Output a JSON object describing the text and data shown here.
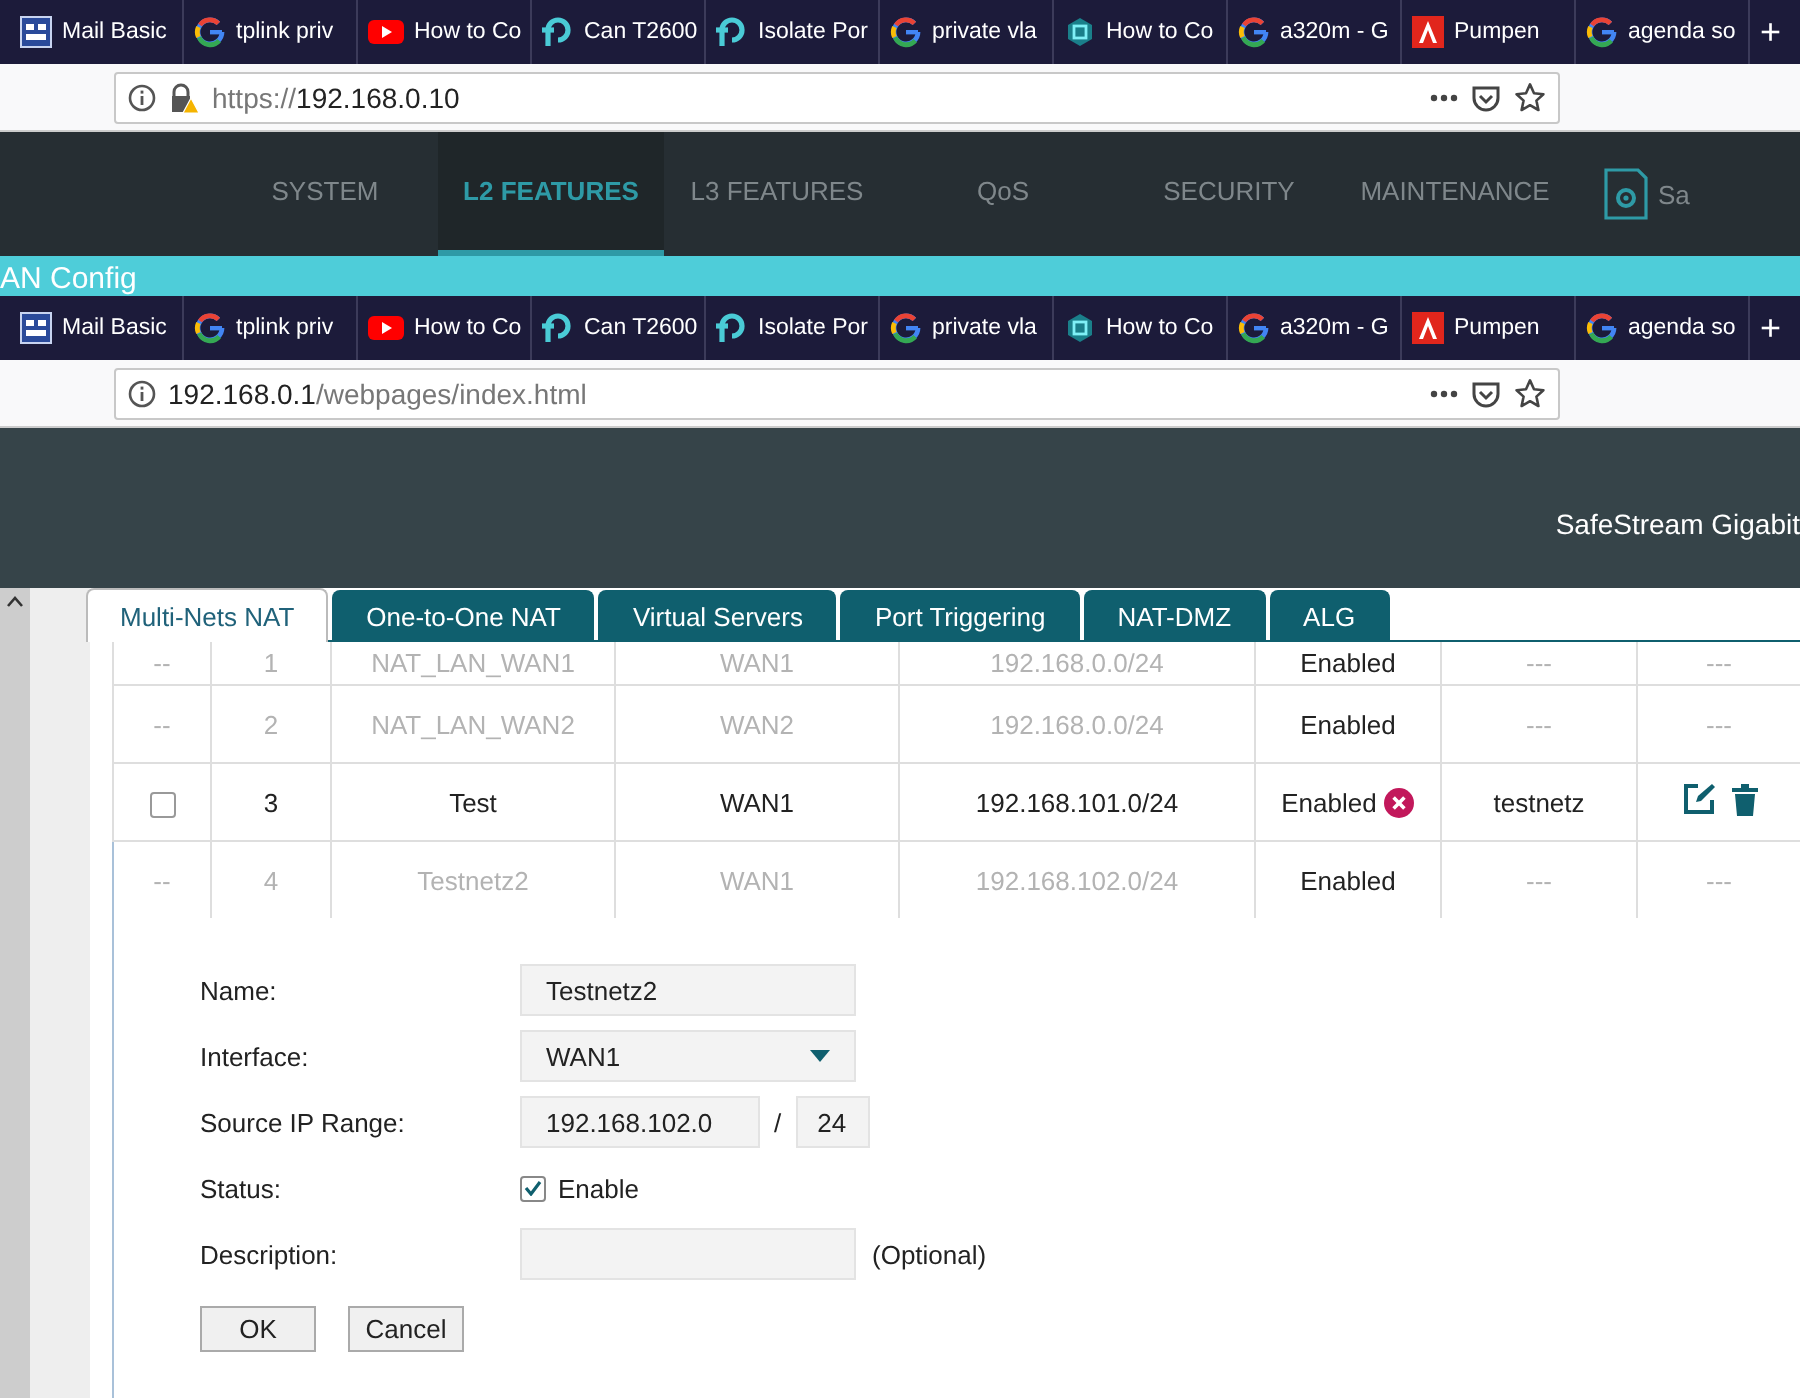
{
  "browser_windows": [
    {
      "tabs": [
        {
          "kind": "mail",
          "title": "Mail Basic"
        },
        {
          "kind": "google",
          "title": "tplink priv"
        },
        {
          "kind": "video",
          "title": "How to Co"
        },
        {
          "kind": "tplink",
          "title": "Can T2600"
        },
        {
          "kind": "tplink",
          "title": "Isolate Por"
        },
        {
          "kind": "google",
          "title": "private vla"
        },
        {
          "kind": "shield",
          "title": "How to Co"
        },
        {
          "kind": "google",
          "title": "a320m - G"
        },
        {
          "kind": "pdf",
          "title": "Pumpen"
        },
        {
          "kind": "google",
          "title": "agenda so"
        }
      ],
      "new_tab_button": "+",
      "address": {
        "scheme": "https://",
        "host": "192.168.0.10",
        "warning": true
      }
    },
    {
      "tabs": [
        {
          "kind": "mail",
          "title": "Mail Basic"
        },
        {
          "kind": "google",
          "title": "tplink priv"
        },
        {
          "kind": "video",
          "title": "How to Co"
        },
        {
          "kind": "tplink",
          "title": "Can T2600"
        },
        {
          "kind": "tplink",
          "title": "Isolate Por"
        },
        {
          "kind": "google",
          "title": "private vla"
        },
        {
          "kind": "shield",
          "title": "How to Co"
        },
        {
          "kind": "google",
          "title": "a320m - G"
        },
        {
          "kind": "pdf",
          "title": "Pumpen"
        },
        {
          "kind": "google",
          "title": "agenda so"
        }
      ],
      "new_tab_button": "+",
      "address": {
        "host": "192.168.0.1",
        "path": "/webpages/index.html",
        "warning": false
      }
    }
  ],
  "top_app": {
    "nav": [
      {
        "label": "SYSTEM",
        "selected": false
      },
      {
        "label": "L2 FEATURES",
        "selected": true
      },
      {
        "label": "L3 FEATURES",
        "selected": false
      },
      {
        "label": "QoS",
        "selected": false
      },
      {
        "label": "SECURITY",
        "selected": false
      },
      {
        "label": "MAINTENANCE",
        "selected": false
      }
    ],
    "save_label": "Sa",
    "page_title": "AN Config"
  },
  "bottom_app": {
    "product": "SafeStream Gigabit",
    "tabs": [
      {
        "label": "Multi-Nets NAT",
        "selected": true
      },
      {
        "label": "One-to-One NAT",
        "selected": false
      },
      {
        "label": "Virtual Servers",
        "selected": false
      },
      {
        "label": "Port Triggering",
        "selected": false
      },
      {
        "label": "NAT-DMZ",
        "selected": false
      },
      {
        "label": "ALG",
        "selected": false
      }
    ],
    "table": {
      "rows": [
        {
          "kind": "preset",
          "select": "--",
          "cells": [
            "1",
            "NAT_LAN_WAN1",
            "WAN1",
            "192.168.0.0/24"
          ],
          "status": "Enabled",
          "description": "---",
          "operation": "---",
          "editing": false
        },
        {
          "kind": "preset",
          "select": "--",
          "cells": [
            "2",
            "NAT_LAN_WAN2",
            "WAN2",
            "192.168.0.0/24"
          ],
          "status": "Enabled",
          "description": "---",
          "operation": "---",
          "editing": false
        },
        {
          "kind": "custom",
          "checked": false,
          "cells": [
            "3",
            "Test",
            "WAN1",
            "192.168.101.0/24"
          ],
          "status": "Enabled",
          "description": "testnetz",
          "editing": false
        },
        {
          "kind": "preset",
          "select": "--",
          "cells": [
            "4",
            "Testnetz2",
            "WAN1",
            "192.168.102.0/24"
          ],
          "status": "Enabled",
          "description": "---",
          "operation": "---",
          "editing": true
        }
      ]
    },
    "form": {
      "fields": [
        {
          "kind": "text",
          "label": "Name:",
          "value": "Testnetz2"
        },
        {
          "kind": "select",
          "label": "Interface:",
          "value": "WAN1"
        },
        {
          "kind": "ip_range",
          "label": "Source IP Range:",
          "value": "192.168.102.0",
          "separator": "/",
          "mask": "24"
        },
        {
          "kind": "checkbox",
          "label": "Status:",
          "option": "Enable",
          "checked": true
        },
        {
          "kind": "text",
          "label": "Description:",
          "note": "(Optional)"
        }
      ],
      "buttons": [
        "OK",
        "Cancel"
      ]
    }
  }
}
